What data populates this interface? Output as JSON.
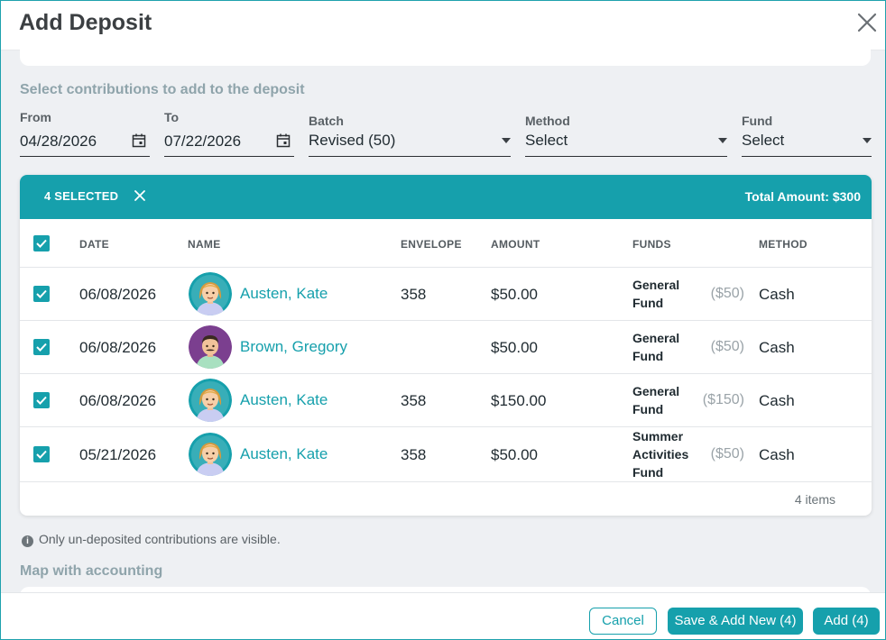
{
  "dialog": {
    "title": "Add Deposit"
  },
  "section": {
    "contributions_title": "Select contributions to add to the deposit",
    "accounting_title": "Map with accounting"
  },
  "filters": {
    "from": {
      "label": "From",
      "value": "04/28/2026"
    },
    "to": {
      "label": "To",
      "value": "07/22/2026"
    },
    "batch": {
      "label": "Batch",
      "value": "Revised (50)"
    },
    "method": {
      "label": "Method",
      "value": "Select"
    },
    "fund": {
      "label": "Fund",
      "value": "Select"
    }
  },
  "selection": {
    "count_label": "4 SELECTED",
    "clear_icon": "close-icon",
    "total_label": "Total Amount: $300"
  },
  "table": {
    "columns": [
      "DATE",
      "NAME",
      "ENVELOPE",
      "AMOUNT",
      "FUNDS",
      "METHOD"
    ],
    "rows": [
      {
        "date": "06/08/2026",
        "name": "Austen, Kate",
        "envelope": "358",
        "amount": "$50.00",
        "fund_line1": "General",
        "fund_line2": "Fund",
        "fund_line3": "",
        "fund_amount": "($50)",
        "method": "Cash",
        "avatar": "female"
      },
      {
        "date": "06/08/2026",
        "name": "Brown, Gregory",
        "envelope": "",
        "amount": "$50.00",
        "fund_line1": "General",
        "fund_line2": "Fund",
        "fund_line3": "",
        "fund_amount": "($50)",
        "method": "Cash",
        "avatar": "male"
      },
      {
        "date": "06/08/2026",
        "name": "Austen, Kate",
        "envelope": "358",
        "amount": "$150.00",
        "fund_line1": "General",
        "fund_line2": "Fund",
        "fund_line3": "",
        "fund_amount": "($150)",
        "method": "Cash",
        "avatar": "female"
      },
      {
        "date": "05/21/2026",
        "name": "Austen, Kate",
        "envelope": "358",
        "amount": "$50.00",
        "fund_line1": "Summer",
        "fund_line2": "Activities",
        "fund_line3": "Fund",
        "fund_amount": "($50)",
        "method": "Cash",
        "avatar": "female"
      }
    ],
    "footer_count": "4 items"
  },
  "note": "Only un-deposited contributions are visible.",
  "buttons": {
    "cancel": "Cancel",
    "save_add_new": "Save & Add New (4)",
    "add": "Add (4)"
  },
  "colors": {
    "accent": "#16a0ac",
    "avatar_female_bg": "#16a0ac",
    "avatar_male_bg": "#7b3f8f"
  }
}
